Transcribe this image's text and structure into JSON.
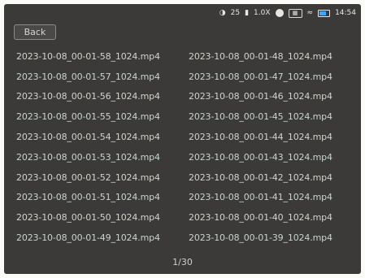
{
  "status_bar": {
    "count": "25",
    "zoom": "1.0X",
    "time": "14:54"
  },
  "back_label": "Back",
  "files": [
    [
      "2023-10-08_00-01-58_1024.mp4",
      "2023-10-08_00-01-48_1024.mp4"
    ],
    [
      "2023-10-08_00-01-57_1024.mp4",
      "2023-10-08_00-01-47_1024.mp4"
    ],
    [
      "2023-10-08_00-01-56_1024.mp4",
      "2023-10-08_00-01-46_1024.mp4"
    ],
    [
      "2023-10-08_00-01-55_1024.mp4",
      "2023-10-08_00-01-45_1024.mp4"
    ],
    [
      "2023-10-08_00-01-54_1024.mp4",
      "2023-10-08_00-01-44_1024.mp4"
    ],
    [
      "2023-10-08_00-01-53_1024.mp4",
      "2023-10-08_00-01-43_1024.mp4"
    ],
    [
      "2023-10-08_00-01-52_1024.mp4",
      "2023-10-08_00-01-42_1024.mp4"
    ],
    [
      "2023-10-08_00-01-51_1024.mp4",
      "2023-10-08_00-01-41_1024.mp4"
    ],
    [
      "2023-10-08_00-01-50_1024.mp4",
      "2023-10-08_00-01-40_1024.mp4"
    ],
    [
      "2023-10-08_00-01-49_1024.mp4",
      "2023-10-08_00-01-39_1024.mp4"
    ]
  ],
  "page_indicator": "1/30"
}
